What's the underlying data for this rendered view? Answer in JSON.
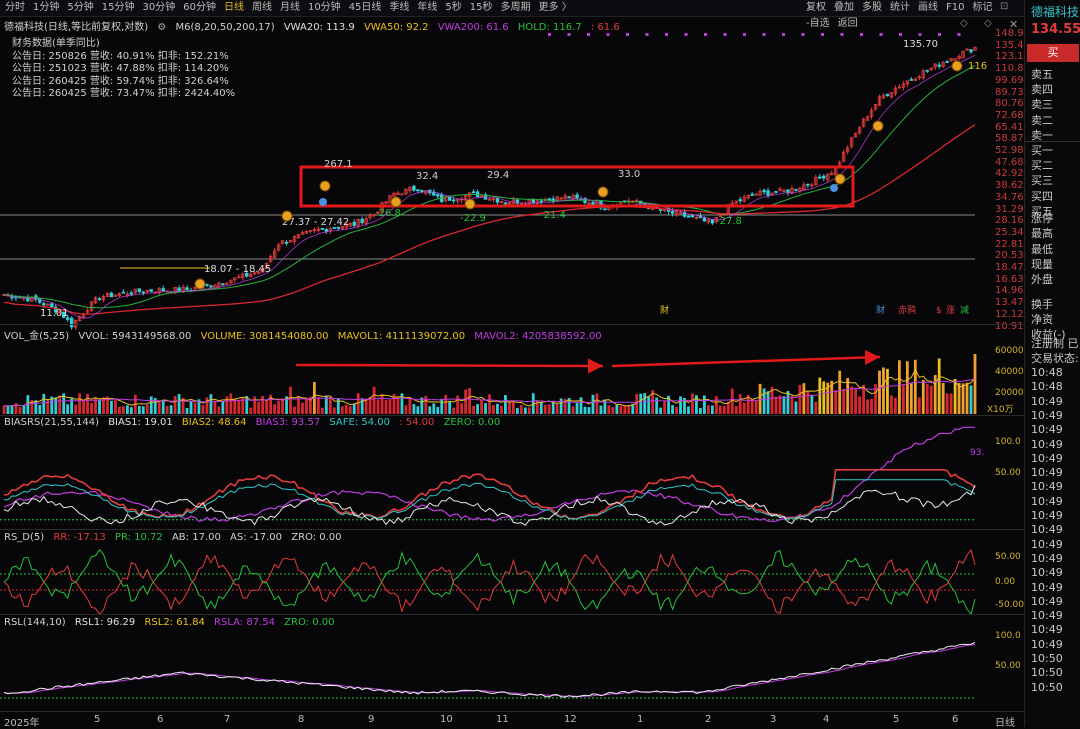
{
  "toolbar": {
    "timeframes": [
      "分时",
      "1分钟",
      "5分钟",
      "15分钟",
      "30分钟",
      "60分钟",
      "日线",
      "周线",
      "月线",
      "10分钟",
      "45日线",
      "季线",
      "年线",
      "5秒",
      "15秒",
      "多周期",
      "更多 〉"
    ],
    "active": "日线",
    "tools": [
      "复权",
      "叠加",
      "多股",
      "统计",
      "画线",
      "F10",
      "标记",
      "-自选",
      "返回"
    ]
  },
  "main": {
    "stock_title": "德福科技(日线,等比前复权,对数)",
    "ma_label": "M6(8,20,50,200,17)",
    "vwa20": "VWA20: 113.9",
    "vwa50": "VWA50: 92.2",
    "vwa200": "VWA200: 61.6",
    "hold": "HOLD: 116.7",
    "hold2": ": 61.6",
    "fin_header": "财务数据(单季同比)",
    "fin_rows": [
      "公告日: 250826  营收: 40.91%  扣非: 152.21%",
      "公告日: 251023  营收: 47.88%  扣非: 114.20%",
      "公告日: 260425  营收: 59.74%  扣非: 326.64%",
      "公告日: 260425  营收: 73.47%  扣非: 2424.40%"
    ],
    "annotations": [
      "135.70",
      "11.01",
      "18.07 - 18.45",
      "27.37 - 27.42",
      "267.1",
      "32.4",
      "29.4",
      "33.0",
      "-26.8",
      "-22.9",
      "-21.4",
      "-27.8",
      "116"
    ],
    "price_axis": [
      "148.9",
      "135.4",
      "123.1",
      "110.8",
      "99.69",
      "89.73",
      "80.76",
      "72.68",
      "65.41",
      "58.87",
      "52.98",
      "47.68",
      "42.92",
      "38.62",
      "34.76",
      "31.29",
      "28.16",
      "25.34",
      "22.81",
      "20.53",
      "18.47",
      "16.63",
      "14.96",
      "13.47",
      "12.12",
      "10.91"
    ],
    "events": [
      "财",
      "赤鸦",
      "$",
      "涨",
      "减"
    ]
  },
  "volume": {
    "title": "VOL_金(5,25)",
    "vvol": "VVOL: 5943149568.00",
    "volume": "VOLUME: 3081454080.00",
    "mavol1": "MAVOL1: 4111139072.00",
    "mavol2": "MAVOL2: 4205838592.00",
    "axis": [
      "60000",
      "40000",
      "20000",
      "X10万"
    ]
  },
  "bias": {
    "title": "BIASRS(21,55,144)",
    "b1": "BIAS1: 19.01",
    "b2": "BIAS2: 48.64",
    "b3": "BIAS3: 93.57",
    "safe": "SAFE: 54.00",
    "extra": ": 54.00",
    "zero": "ZERO: 0.00",
    "axis": [
      "100.0",
      "50.00",
      "93."
    ]
  },
  "rsd": {
    "title": "RS_D(5)",
    "rr": "RR: -17.13",
    "pr": "PR: 10.72",
    "ab": "AB: 17.00",
    "as": "AS: -17.00",
    "zro": "ZRO: 0.00",
    "axis": [
      "50.00",
      "0.00",
      "-50.00"
    ]
  },
  "rsl": {
    "title": "RSL(144,10)",
    "r1": "RSL1: 96.29",
    "r2": "RSL2: 61.84",
    "rsla": "RSLA: 87.54",
    "zro": "ZRO: 0.00",
    "axis": [
      "100.0",
      "50.00"
    ]
  },
  "x_axis": {
    "months": [
      "2025年",
      "5",
      "6",
      "7",
      "8",
      "9",
      "10",
      "11",
      "12",
      "1",
      "2",
      "3",
      "4",
      "5",
      "6"
    ],
    "label": "日线"
  },
  "right_panel": {
    "name": "德福科技",
    "price": "134.55",
    "buy_button": "买",
    "order_book": [
      "卖五",
      "卖四",
      "卖三",
      "卖二",
      "卖一",
      "买一",
      "买二",
      "买三",
      "买四",
      "买五"
    ],
    "stats": [
      "涨停",
      "最高",
      "最低",
      "现量",
      "外盘",
      "换手",
      "净资",
      "收益(-)"
    ],
    "reg": "注册制 已",
    "status": "交易状态: ",
    "times": [
      "10:48",
      "10:48",
      "10:49",
      "10:49",
      "10:49",
      "10:49",
      "10:49",
      "10:49",
      "10:49",
      "10:49",
      "10:49",
      "10:49",
      "10:49",
      "10:49",
      "10:49",
      "10:49",
      "10:49",
      "10:49",
      "10:49",
      "10:49",
      "10:50",
      "10:50",
      "10:50"
    ]
  },
  "colors": {
    "up": "#e23b3b",
    "down": "#33d0d8",
    "ma_red": "#d8282e",
    "ma_green": "#27b13a",
    "purple": "#c03ce0",
    "yellow": "#e8c020",
    "box": "#e21a1a"
  }
}
